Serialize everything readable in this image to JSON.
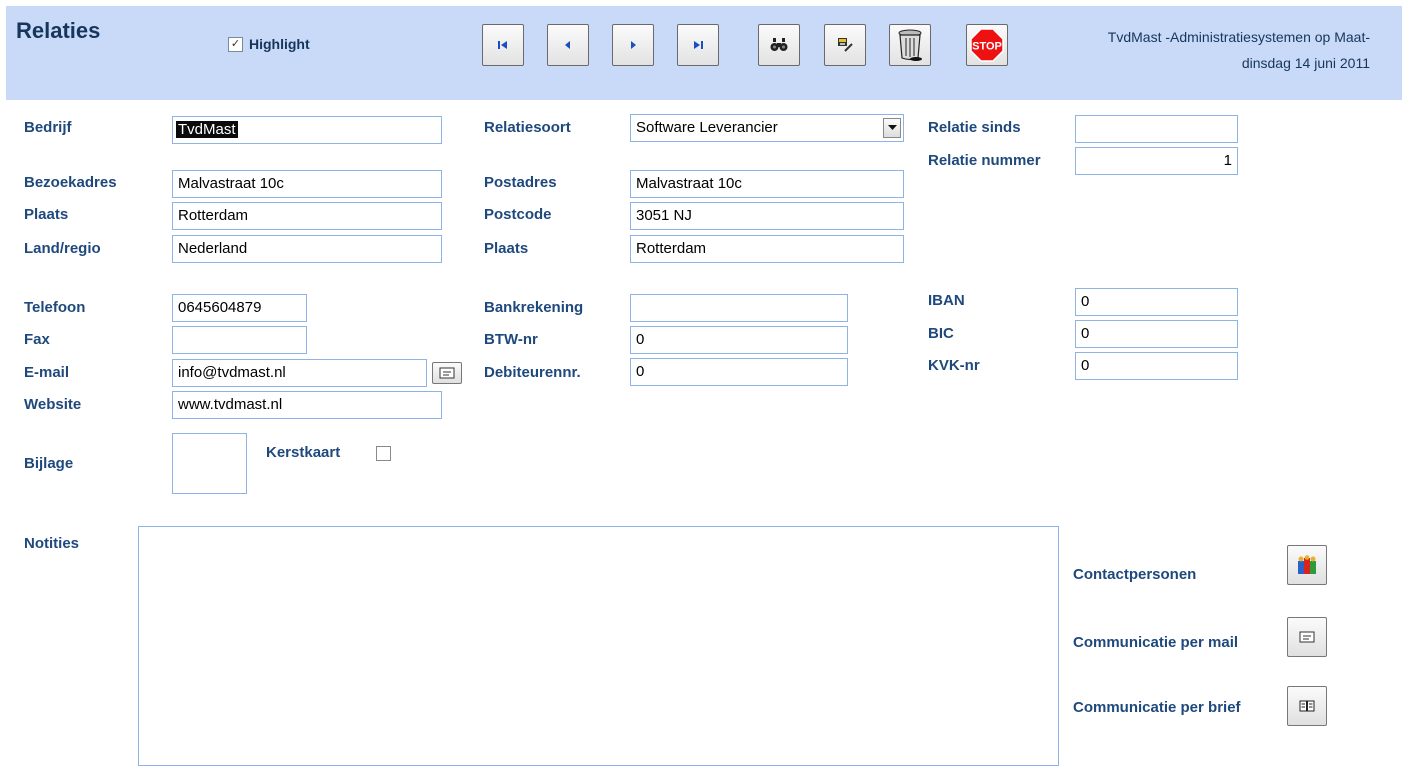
{
  "header": {
    "title": "Relaties",
    "highlight_label": "Highlight",
    "highlight_checked": true,
    "company_line": "TvdMast  -Administratiesystemen op Maat-",
    "date_line": "dinsdag 14 juni 2011",
    "toolbar": [
      {
        "name": "first-record",
        "icon": "first-record-icon"
      },
      {
        "name": "prev-record",
        "icon": "prev-record-icon"
      },
      {
        "name": "next-record",
        "icon": "next-record-icon"
      },
      {
        "name": "last-record",
        "icon": "last-record-icon"
      },
      {
        "name": "find",
        "icon": "binoculars-icon"
      },
      {
        "name": "edit",
        "icon": "edit-icon"
      },
      {
        "name": "delete",
        "icon": "trash-icon"
      },
      {
        "name": "stop",
        "icon": "stop-icon",
        "label": "STOP"
      }
    ]
  },
  "labels": {
    "bedrijf": "Bedrijf",
    "bezoekadres": "Bezoekadres",
    "plaats": "Plaats",
    "land": "Land/regio",
    "telefoon": "Telefoon",
    "fax": "Fax",
    "email": "E-mail",
    "website": "Website",
    "bijlage": "Bijlage",
    "kerstkaart": "Kerstkaart",
    "relatiesoort": "Relatiesoort",
    "postadres": "Postadres",
    "postcode": "Postcode",
    "plaats2": "Plaats",
    "bankrekening": "Bankrekening",
    "btw": "BTW-nr",
    "debiteur": "Debiteurennr.",
    "relatie_sinds": "Relatie sinds",
    "relatie_nummer": "Relatie nummer",
    "iban": "IBAN",
    "bic": "BIC",
    "kvk": "KVK-nr",
    "notities": "Notities"
  },
  "values": {
    "bedrijf": "TvdMast",
    "bezoekadres": "Malvastraat 10c",
    "plaats": "Rotterdam",
    "land": "Nederland",
    "telefoon": "0645604879",
    "fax": "",
    "email": "info@tvdmast.nl",
    "website": "www.tvdmast.nl",
    "relatiesoort": "Software Leverancier",
    "postadres": "Malvastraat 10c",
    "postcode": "3051 NJ",
    "plaats2": "Rotterdam",
    "bankrekening": "",
    "btw": "0",
    "debiteur": "0",
    "relatie_sinds": "",
    "relatie_nummer": "1",
    "iban": "0",
    "bic": "0",
    "kvk": "0",
    "notities": "",
    "kerstkaart_checked": false
  },
  "actions": {
    "contactpersonen": "Contactpersonen",
    "mail": "Communicatie per mail",
    "brief": "Communicatie per brief"
  },
  "colors": {
    "header_bg": "#c9daf8",
    "label_color": "#1f497d",
    "field_border": "#8eb4e3"
  }
}
